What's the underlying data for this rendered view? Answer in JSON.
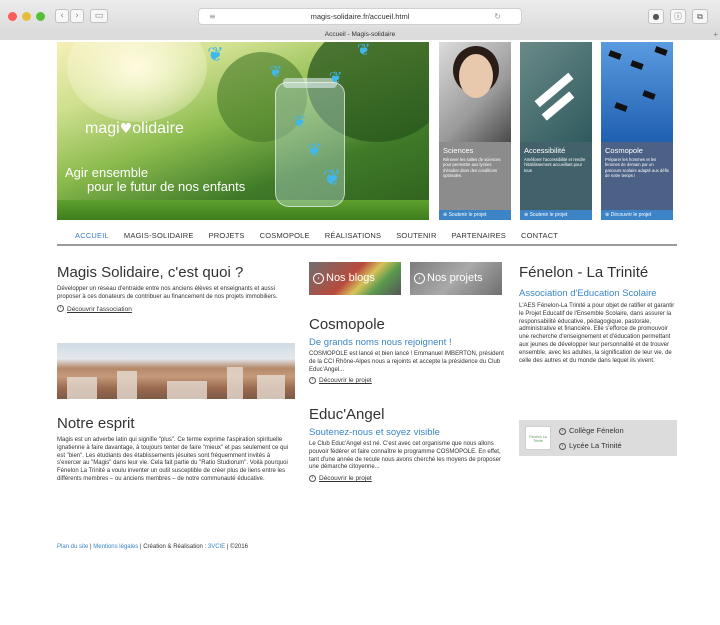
{
  "browser": {
    "url": "magis-solidaire.fr/accueil.html",
    "tab_title": "Accueil - Magis-solidaire",
    "back_icon": "‹",
    "forward_icon": "›",
    "sidebar_icon": "▭",
    "menu_icon": "≡",
    "reload_icon": "↻",
    "right_icons": [
      "●",
      "ⓘ",
      "⧉"
    ],
    "newtab_icon": "+"
  },
  "hero": {
    "logo_text": "magi",
    "logo_heart": "♥",
    "logo_suffix": "olidaire",
    "tagline_line1": "Agir ensemble",
    "tagline_line2": "pour le futur de nos enfants"
  },
  "panels": [
    {
      "title": "Sciences",
      "text": "Rénover les salles de sciences pour permettre aux lycées d'étudier dans des conditions optimales.",
      "button": "Soutenir le projet",
      "color": "#3c84c6"
    },
    {
      "title": "Accessibilité",
      "text": "Améliorer l'accessibilité et rendre l'établissement accueillant pour tous",
      "button": "Soutenir le projet",
      "color": "#3c84c6"
    },
    {
      "title": "Cosmopole",
      "text": "Préparer les hommes et les femmes de demain par un parcours scolaire adapté aux défis de notre temps !",
      "button": "Découvrir le projet",
      "color": "#3c84c6"
    }
  ],
  "panel_icon": "⊕",
  "nav": [
    "ACCUEIL",
    "MAGIS-SOLIDAIRE",
    "PROJETS",
    "COSMOPOLE",
    "RÉALISATIONS",
    "SOUTENIR",
    "PARTENAIRES",
    "CONTACT"
  ],
  "nav_active_color": "#3a7fc4",
  "left": {
    "title": "Magis Solidaire, c'est quoi ?",
    "text": "Développer un réseau d'entraide entre nos anciens élèves et enseignants et aussi proposer à ces donateurs de contribuer au financement de nos projets immobiliers.",
    "link": "Découvrir l'association",
    "esprit_title": "Notre esprit",
    "esprit_text": "Magis est un adverbe latin qui signifie \"plus\". Ce terme exprime l'aspiration spirituelle ignatienne à faire davantage, à toujours tenter de faire \"mieux\" et pas seulement ce qui est \"bien\". Les étudiants des établissements jésuites sont fréquemment invités à s'exercer au \"Magis\" dans leur vie. Cela fait partie du \"Ratio Studiorum\". Voilà pourquoi Fénelon La Trinité a voulu inventer un outil susceptible de créer plus de liens entre les différents membres – ou anciens membres – de notre communauté éducative."
  },
  "middle": {
    "blogs": "Nos blogs",
    "projets": "Nos projets",
    "cosmo_title": "Cosmopole",
    "cosmo_sub": "De grands noms nous rejoignent !",
    "cosmo_text": "COSMOPOLE est lancé et bien lancé ! Emmanuel IMBERTON, président de la CCI Rhône-Alpes nous a rejoints et accepte la présidence du Club Educ'Angel...",
    "cosmo_link": "Découvrir le projet",
    "educ_title": "Educ'Angel",
    "educ_sub": "Soutenez-nous et soyez visible",
    "educ_text": "Le Club Educ'Angel est né. C'est avec cet organisme que nous allons pouvoir fédérer et faire connaître le programme COSMOPOLE. En effet, tant d'une année de recule nous avons cherché les moyens de proposer une démarche citoyenne...",
    "educ_link": "Découvrir le projet"
  },
  "right": {
    "title": "Fénelon - La Trinité",
    "sub": "Association d'Education Scolaire",
    "text": "L'AES Fénelon-La Trinité a pour objet de ratifier et garantir le Projet Educatif de l'Ensemble Scolaire, dans assurer la responsabilité éducative, pédagogique, pastorale, administrative et financière. Elle s'efforce de promouvoir une recherche d'enseignement et d'éducation permettant aux jeunes de développer leur personnalité et de trouver ensemble, avec les adultes, la signification de leur vie, de celle des autres et du monde dans lequel ils vivent.",
    "college1": "Collège Fénelon",
    "college2": "Lycée La Trinité",
    "logo_text": "Fénelon La Trinité"
  },
  "footer": {
    "plan": "Plan du site",
    "mentions": "Mentions légales",
    "credit": "| Création & Réalisation :",
    "agency": "3VCIE",
    "year": "| ©2016"
  },
  "arrow_icon": "›"
}
